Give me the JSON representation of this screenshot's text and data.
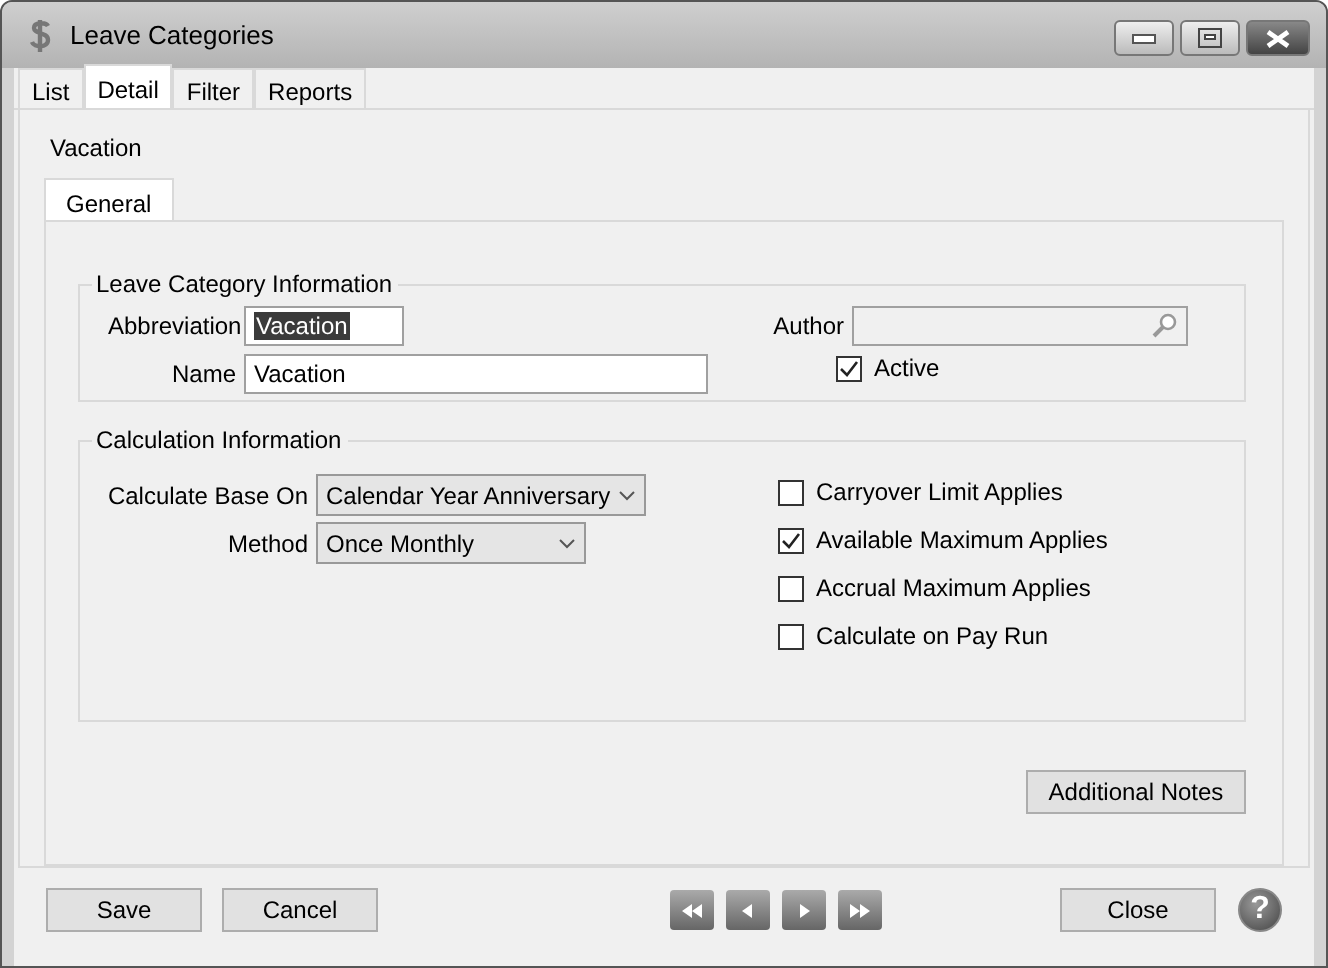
{
  "window": {
    "title": "Leave Categories"
  },
  "tabs": [
    {
      "label": "List",
      "selected": false
    },
    {
      "label": "Detail",
      "selected": true
    },
    {
      "label": "Filter",
      "selected": false
    },
    {
      "label": "Reports",
      "selected": false
    }
  ],
  "record_title": "Vacation",
  "subtabs": [
    {
      "label": "General",
      "selected": true
    }
  ],
  "leave_info": {
    "title": "Leave Category Information",
    "abbreviation": {
      "label": "Abbreviation",
      "value": "Vacation",
      "text_selected": true
    },
    "name": {
      "label": "Name",
      "value": "Vacation"
    },
    "author": {
      "label": "Author"
    },
    "active": {
      "label": "Active",
      "checked": true
    }
  },
  "calc_info": {
    "title": "Calculation Information",
    "base_on": {
      "label": "Calculate Base On",
      "value": "Calendar Year Anniversary"
    },
    "method": {
      "label": "Method",
      "value": "Once Monthly"
    },
    "options": [
      {
        "label": "Carryover Limit Applies",
        "checked": false
      },
      {
        "label": "Available Maximum Applies",
        "checked": true
      },
      {
        "label": "Accrual Maximum Applies",
        "checked": false
      },
      {
        "label": "Calculate on Pay Run",
        "checked": false
      }
    ]
  },
  "additional_notes_button": "Additional Notes",
  "footer": {
    "buttons": [
      "Save",
      "Cancel"
    ],
    "close": "Close",
    "help": "?"
  }
}
